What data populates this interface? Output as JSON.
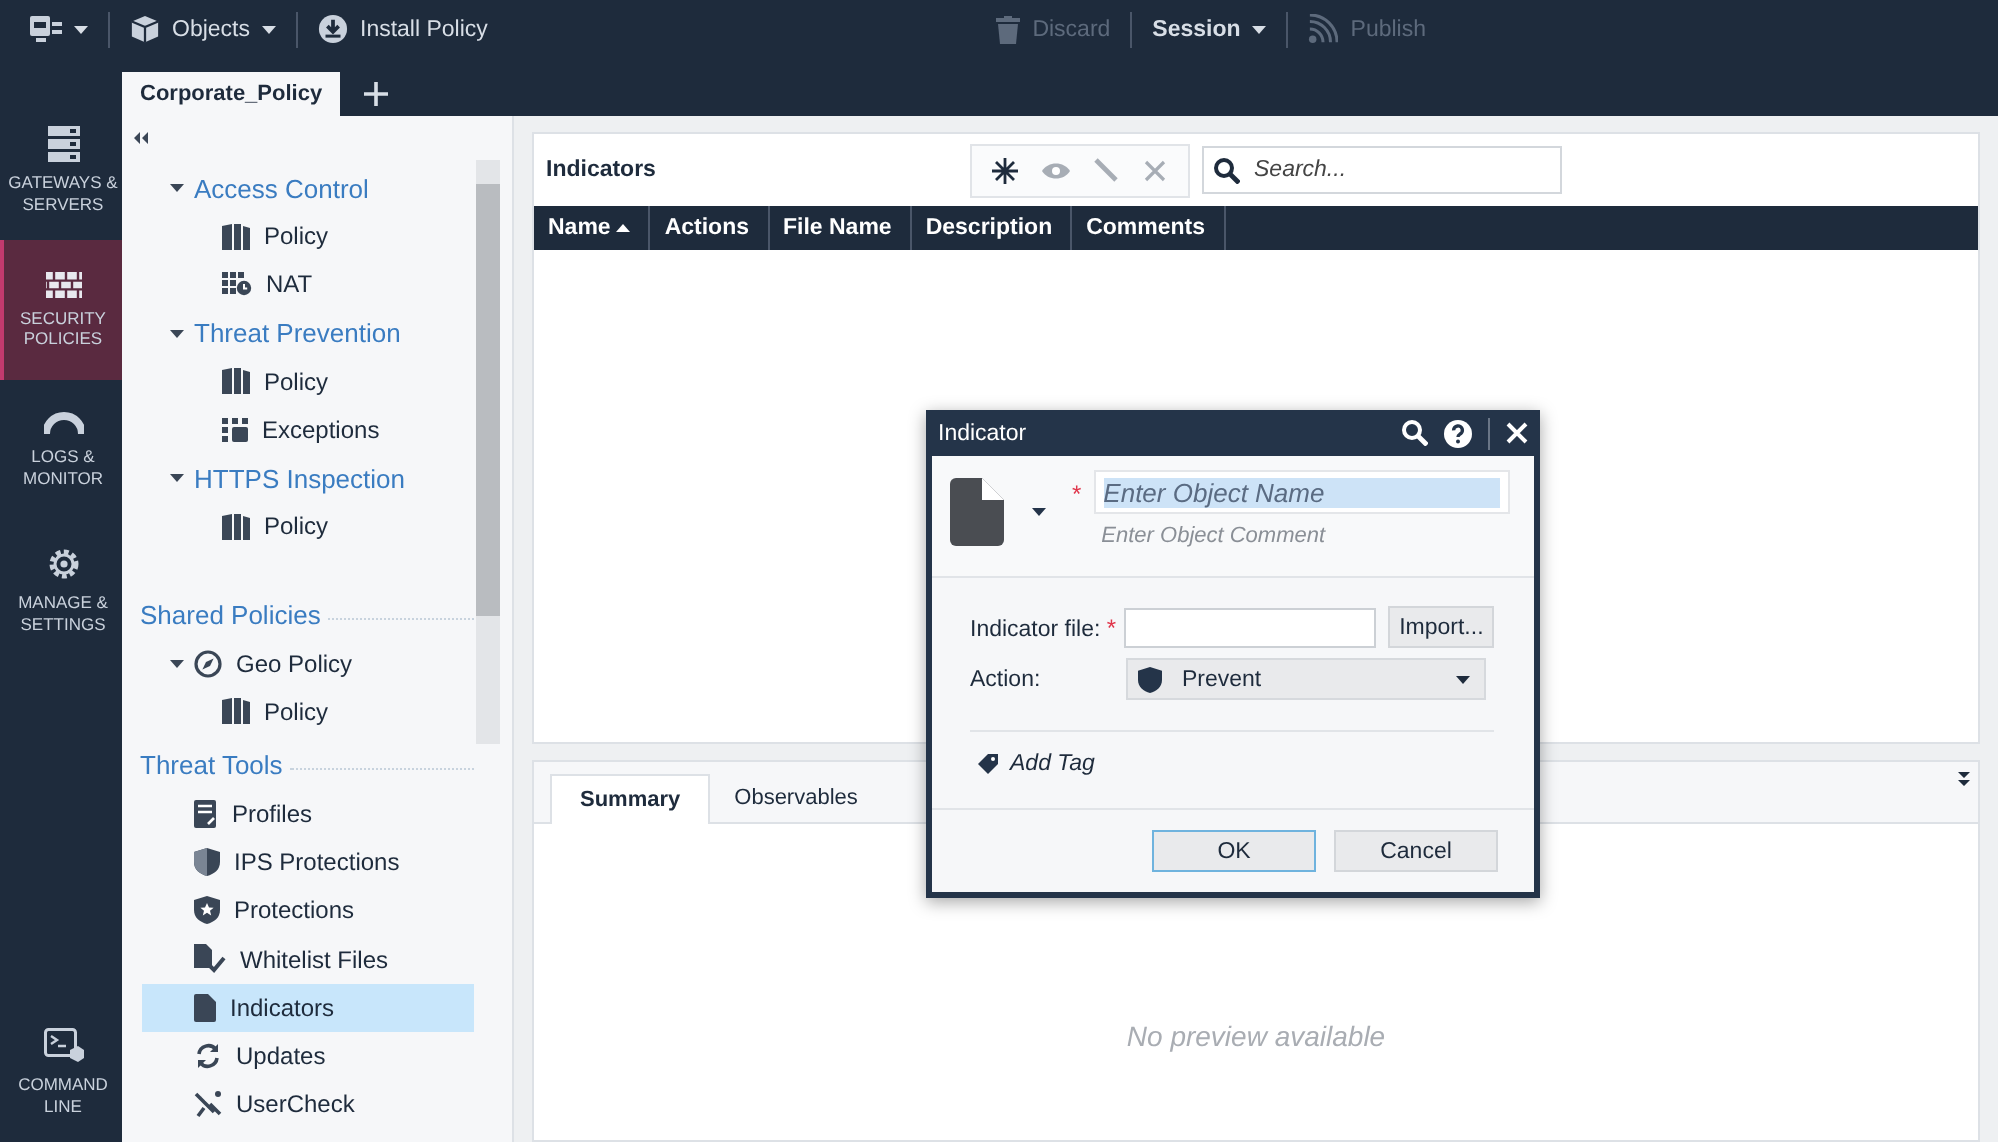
{
  "top_bar": {
    "left": [
      {
        "kind": "app_menu",
        "caret": true,
        "disabled": false
      },
      {
        "kind": "objects",
        "label": "Objects",
        "caret": true,
        "disabled": false
      },
      {
        "kind": "install",
        "label": "Install Policy",
        "caret": false,
        "disabled": false
      }
    ],
    "right": [
      {
        "kind": "discard",
        "label": "Discard",
        "caret": false,
        "disabled": true
      },
      {
        "kind": "session",
        "label": "Session",
        "caret": true,
        "disabled": false
      },
      {
        "kind": "publish",
        "label": "Publish",
        "caret": false,
        "disabled": true
      }
    ]
  },
  "nav": [
    {
      "kind": "gateways",
      "label": "GATEWAYS & SERVERS",
      "selected": false
    },
    {
      "kind": "policies",
      "label": "SECURITY POLICIES",
      "selected": true
    },
    {
      "kind": "logs",
      "label": "LOGS & MONITOR",
      "selected": false
    },
    {
      "kind": "manage",
      "label": "MANAGE & SETTINGS",
      "selected": false
    },
    {
      "kind": "command",
      "label": "COMMAND LINE",
      "selected": false
    }
  ],
  "tabs": [
    {
      "label": "Corporate_Policy",
      "selected": true
    }
  ],
  "sidebar": {
    "tree": [
      {
        "kind": "folder",
        "label": "Access Control",
        "expanded": true,
        "selected": false,
        "children": [
          {
            "kind": "policy",
            "label": "Policy",
            "selected": false
          },
          {
            "kind": "nat",
            "label": "NAT",
            "selected": false
          }
        ]
      },
      {
        "kind": "folder",
        "label": "Threat Prevention",
        "expanded": true,
        "selected": false,
        "children": [
          {
            "kind": "policy",
            "label": "Policy",
            "selected": false
          },
          {
            "kind": "exceptions",
            "label": "Exceptions",
            "selected": false
          }
        ]
      },
      {
        "kind": "folder",
        "label": "HTTPS Inspection",
        "expanded": true,
        "selected": false,
        "children": [
          {
            "kind": "policy",
            "label": "Policy",
            "selected": false
          }
        ]
      },
      {
        "kind": "section",
        "label": "Shared Policies",
        "selected": false,
        "children": [
          {
            "kind": "geo",
            "label": "Geo Policy",
            "expanded": true,
            "selected": false,
            "children": [
              {
                "kind": "policy",
                "label": "Policy",
                "selected": false
              }
            ]
          }
        ]
      },
      {
        "kind": "section",
        "label": "Threat Tools",
        "selected": false,
        "children": [
          {
            "kind": "profiles",
            "label": "Profiles",
            "selected": false
          },
          {
            "kind": "ips",
            "label": "IPS Protections",
            "selected": false
          },
          {
            "kind": "protections",
            "label": "Protections",
            "selected": false
          },
          {
            "kind": "whitelist",
            "label": "Whitelist Files",
            "selected": false
          },
          {
            "kind": "indicators",
            "label": "Indicators",
            "selected": true
          },
          {
            "kind": "updates",
            "label": "Updates",
            "selected": false
          },
          {
            "kind": "usercheck",
            "label": "UserCheck",
            "selected": false
          }
        ]
      }
    ]
  },
  "main": {
    "title": "Indicators",
    "tools": [
      {
        "kind": "new",
        "disabled": false
      },
      {
        "kind": "view",
        "disabled": true
      },
      {
        "kind": "edit",
        "disabled": true
      },
      {
        "kind": "delete",
        "disabled": true
      }
    ],
    "search": {
      "placeholder": "Search..."
    },
    "table": {
      "columns": [
        {
          "label": "Name",
          "sorted": true
        },
        {
          "label": "Actions",
          "sorted": false
        },
        {
          "label": "File Name",
          "sorted": false
        },
        {
          "label": "Description",
          "sorted": false
        },
        {
          "label": "Comments",
          "sorted": false
        }
      ]
    },
    "details": {
      "tabs": [
        {
          "label": "Summary",
          "selected": true
        },
        {
          "label": "Observables",
          "selected": false
        }
      ],
      "empty_text": "No preview available"
    }
  },
  "dialog": {
    "title": "Indicator",
    "name_field": {
      "placeholder": "Enter Object Name",
      "highlighted": true,
      "required_mark": "*"
    },
    "comment_field": {
      "placeholder": "Enter Object Comment"
    },
    "file_field": {
      "label": "Indicator file:",
      "required_mark": "*",
      "button": "Import..."
    },
    "action_field": {
      "label": "Action:",
      "value": "Prevent"
    },
    "add_tag": "Add Tag",
    "buttons": [
      {
        "label": "OK",
        "default": true
      },
      {
        "label": "Cancel",
        "default": false
      }
    ]
  }
}
